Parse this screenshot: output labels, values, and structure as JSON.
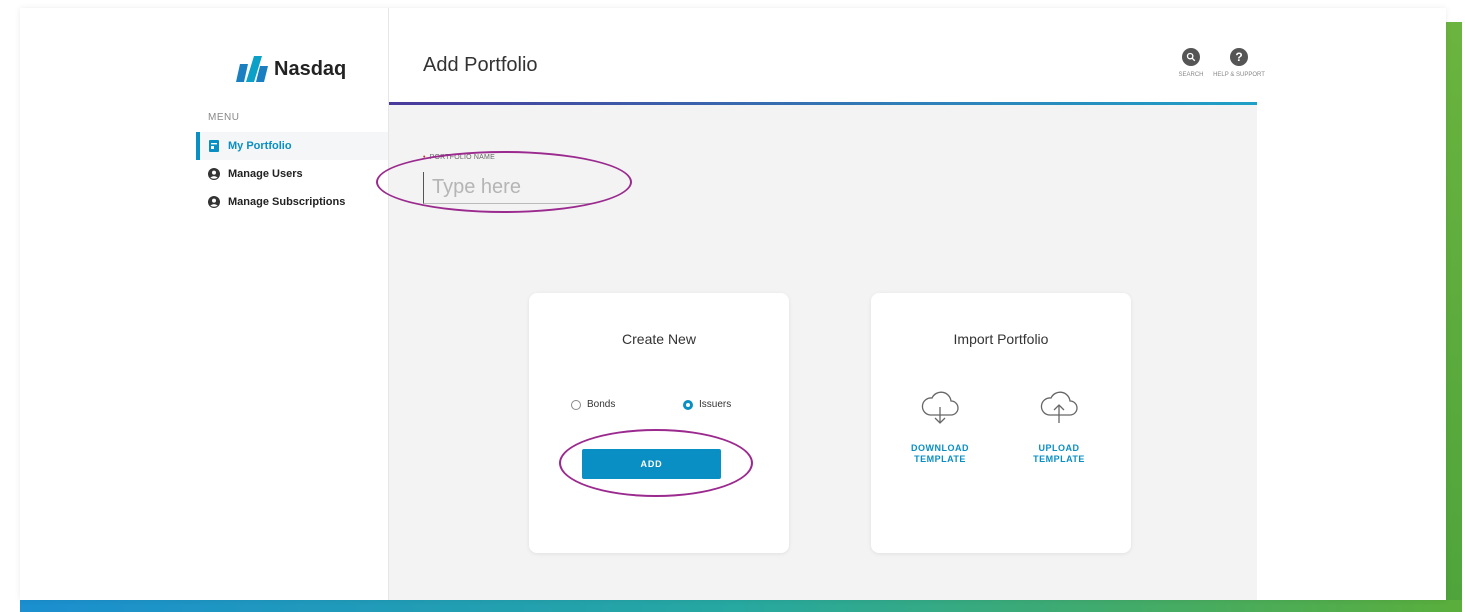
{
  "brand": {
    "name": "Nasdaq"
  },
  "sidebar": {
    "menu_label": "MENU",
    "items": [
      {
        "label": "My Portfolio",
        "icon": "portfolio-icon",
        "active": true
      },
      {
        "label": "Manage Users",
        "icon": "user-circle-icon",
        "active": false
      },
      {
        "label": "Manage Subscriptions",
        "icon": "user-circle-icon",
        "active": false
      }
    ]
  },
  "header": {
    "title": "Add Portfolio",
    "search_label": "SEARCH",
    "help_label": "HELP & SUPPORT"
  },
  "form": {
    "portfolio_name_label": "PORTFOLIO NAME",
    "portfolio_name_placeholder": "Type here",
    "portfolio_name_value": ""
  },
  "create_card": {
    "title": "Create New",
    "options": [
      {
        "label": "Bonds",
        "selected": false
      },
      {
        "label": "Issuers",
        "selected": true
      }
    ],
    "add_label": "ADD"
  },
  "import_card": {
    "title": "Import Portfolio",
    "download_line1": "DOWNLOAD",
    "download_line2": "TEMPLATE",
    "upload_line1": "UPLOAD",
    "upload_line2": "TEMPLATE"
  },
  "colors": {
    "accent": "#0a8fc4",
    "annotation": "#9b2a8f",
    "frame_green": "#5aae3b"
  }
}
